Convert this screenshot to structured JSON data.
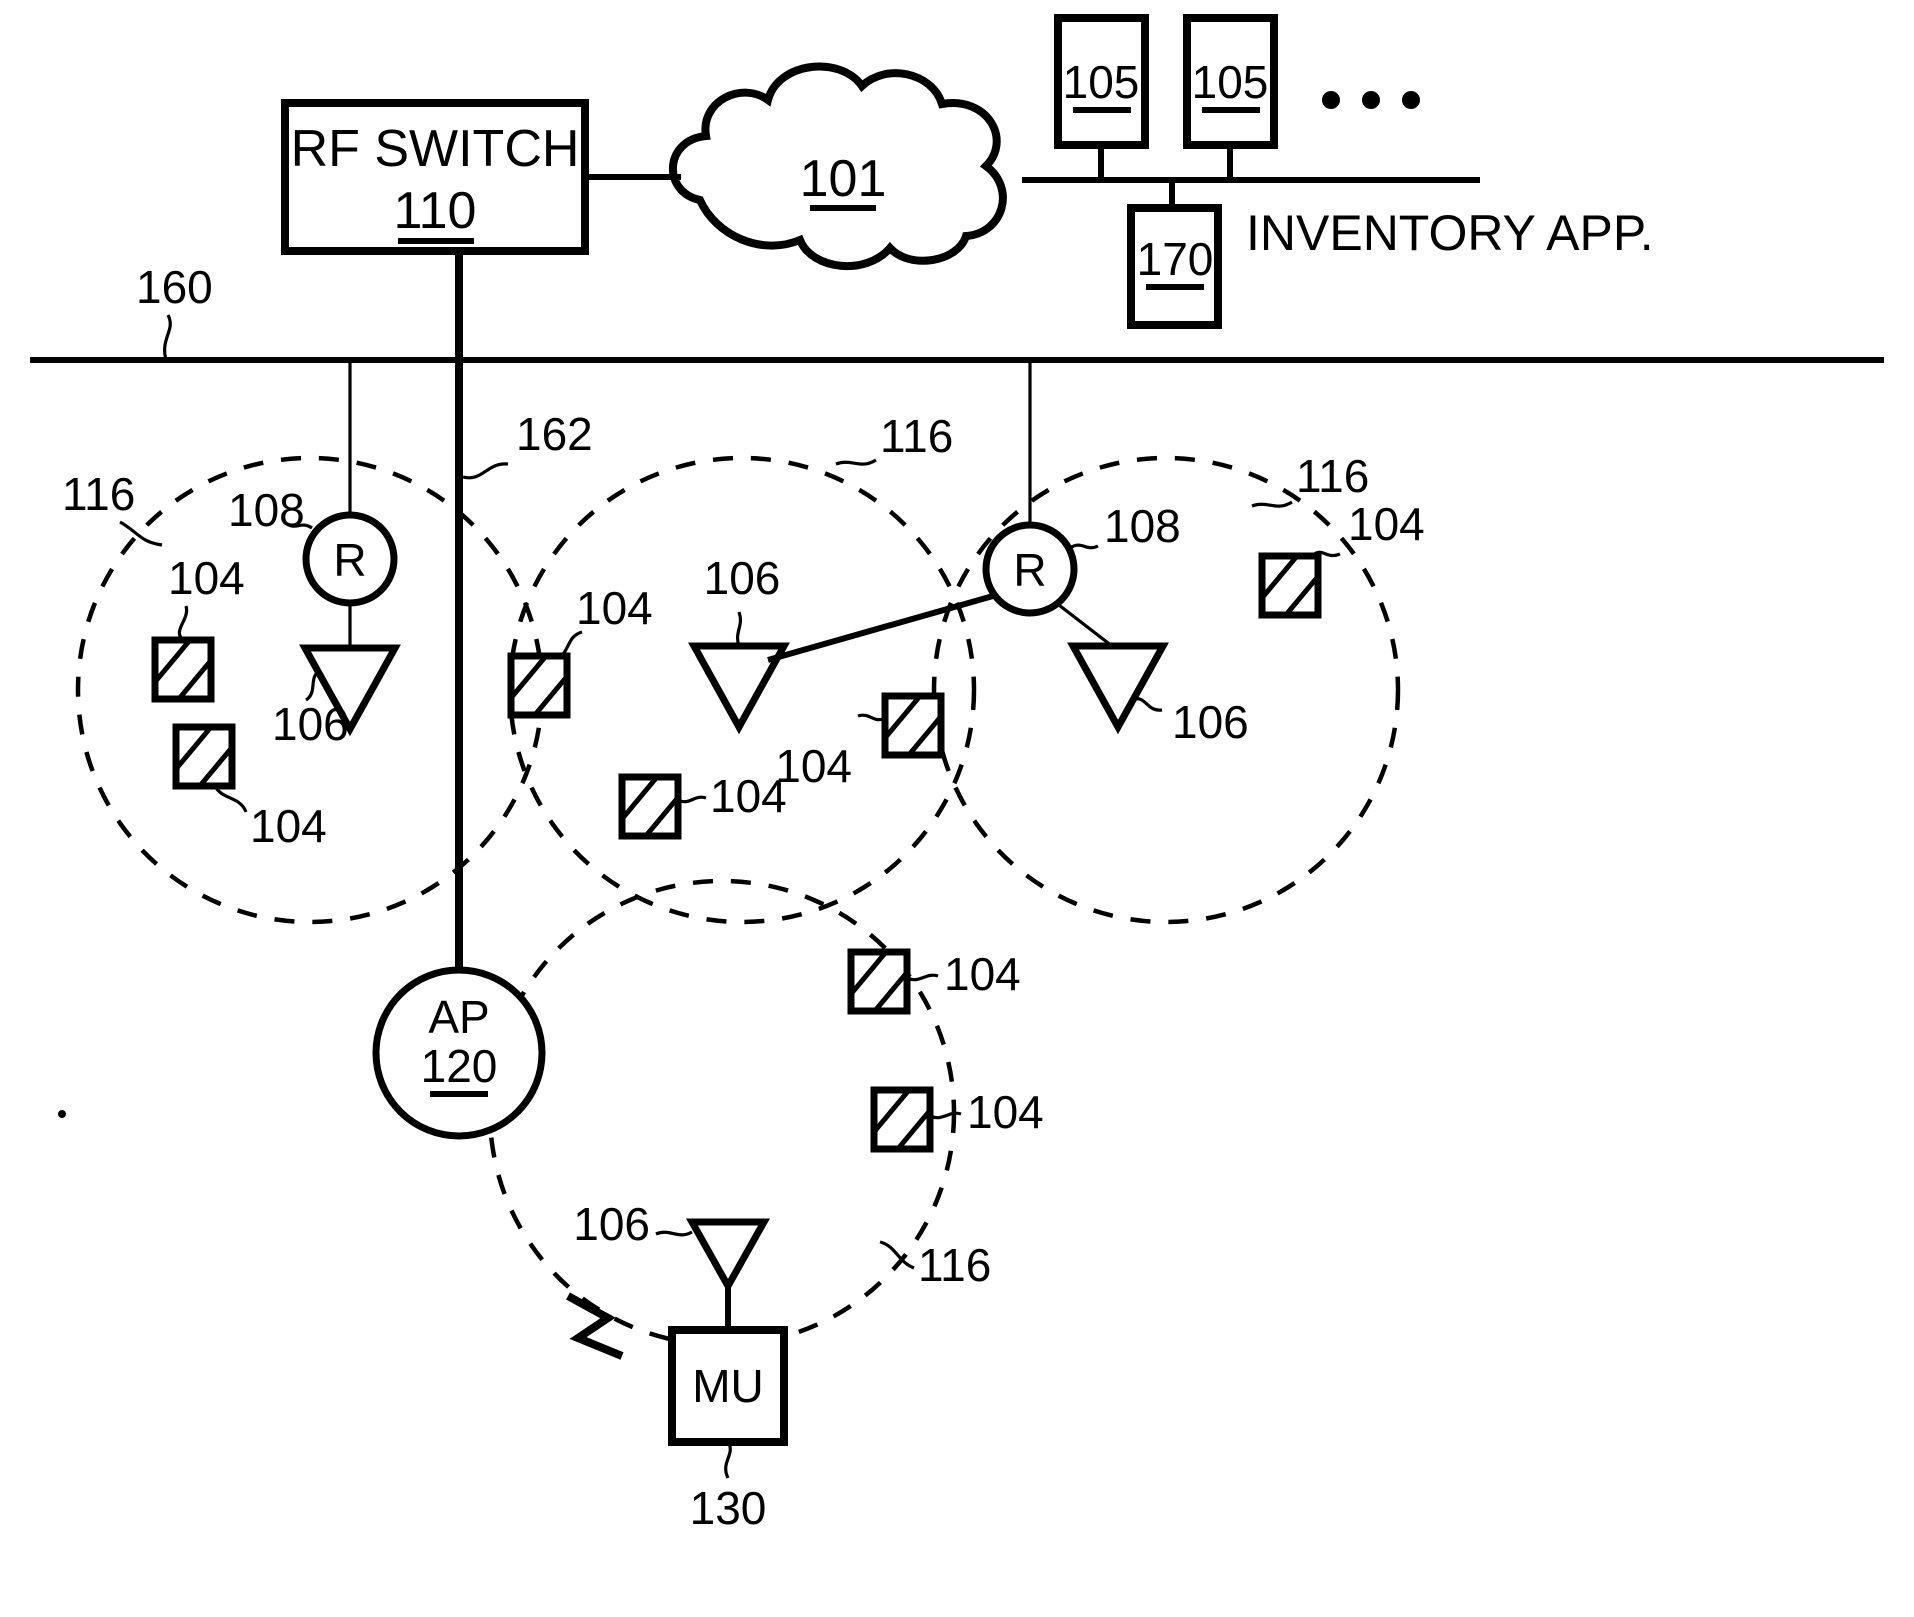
{
  "figure": {
    "title": "RF switch wireless network topology diagram",
    "background_color": "#ffffff",
    "line_color": "#000000"
  },
  "nodes": {
    "rf_switch": {
      "label": "RF SWITCH",
      "ref": "110"
    },
    "network_cloud": {
      "ref": "101"
    },
    "server_1": {
      "ref": "105"
    },
    "server_2": {
      "ref": "105"
    },
    "server_more": {
      "label": ". . ."
    },
    "inventory_host": {
      "ref": "170"
    },
    "inventory_app": {
      "label": "INVENTORY APP."
    },
    "access_point": {
      "label": "AP",
      "ref": "120"
    },
    "mobile_unit": {
      "label": "MU",
      "ref": "130"
    },
    "reader_left": {
      "label": "R",
      "ref": "108"
    },
    "reader_right": {
      "label": "R",
      "ref": "108"
    }
  },
  "refs": {
    "backbone": "160",
    "cable_162": "162",
    "cell_left": "116",
    "cell_center": "116",
    "cell_right": "116",
    "cell_bottom": "116",
    "antenna": "106",
    "tag": "104"
  },
  "labels": {
    "tag_callouts": [
      "104",
      "104",
      "104",
      "104",
      "104",
      "104",
      "104",
      "104",
      "104",
      "104"
    ],
    "antenna_callouts": [
      "106",
      "106",
      "106",
      "106"
    ],
    "reader_callouts": [
      "108",
      "108"
    ],
    "cell_callouts": [
      "116",
      "116",
      "116",
      "116"
    ]
  },
  "icons": {
    "rf_switch": "rf-switch-box-icon",
    "cloud": "network-cloud-icon",
    "server": "server-box-icon",
    "reader": "rfid-reader-circle-icon",
    "antenna": "antenna-triangle-icon",
    "tag": "rfid-tag-hatched-square-icon",
    "access_point": "access-point-circle-icon",
    "mobile_unit": "mobile-unit-box-icon",
    "wireless_link": "lightning-bolt-icon",
    "cell": "coverage-cell-dashed-circle-icon",
    "ellipsis": "ellipsis-dots-icon"
  }
}
